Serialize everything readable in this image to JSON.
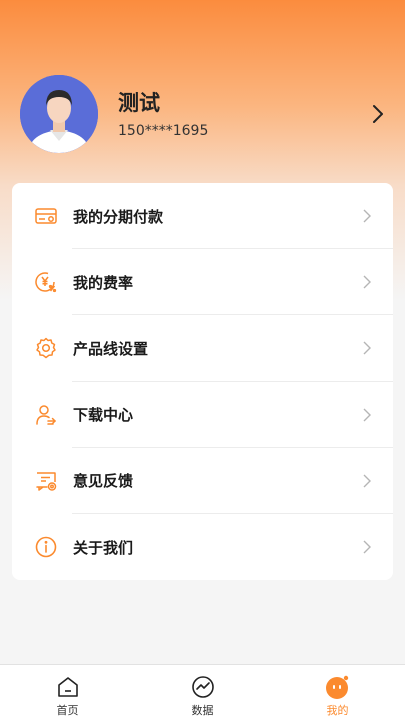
{
  "colors": {
    "accent": "#fb8a2e",
    "avatar_bg": "#5a6dd8"
  },
  "profile": {
    "name": "测试",
    "phone": "150****1695",
    "avatar_icon": "user-avatar",
    "arrow_icon": "chevron-right-icon"
  },
  "menu": {
    "items": [
      {
        "label": "我的分期付款",
        "icon": "installment-card-icon"
      },
      {
        "label": "我的费率",
        "icon": "rate-yen-icon"
      },
      {
        "label": "产品线设置",
        "icon": "settings-gear-icon"
      },
      {
        "label": "下载中心",
        "icon": "download-user-icon"
      },
      {
        "label": "意见反馈",
        "icon": "feedback-icon"
      },
      {
        "label": "关于我们",
        "icon": "info-icon"
      }
    ]
  },
  "tabbar": {
    "tabs": [
      {
        "label": "首页",
        "icon": "home-icon",
        "active": false
      },
      {
        "label": "数据",
        "icon": "data-chart-icon",
        "active": false
      },
      {
        "label": "我的",
        "icon": "mine-face-icon",
        "active": true
      }
    ]
  }
}
